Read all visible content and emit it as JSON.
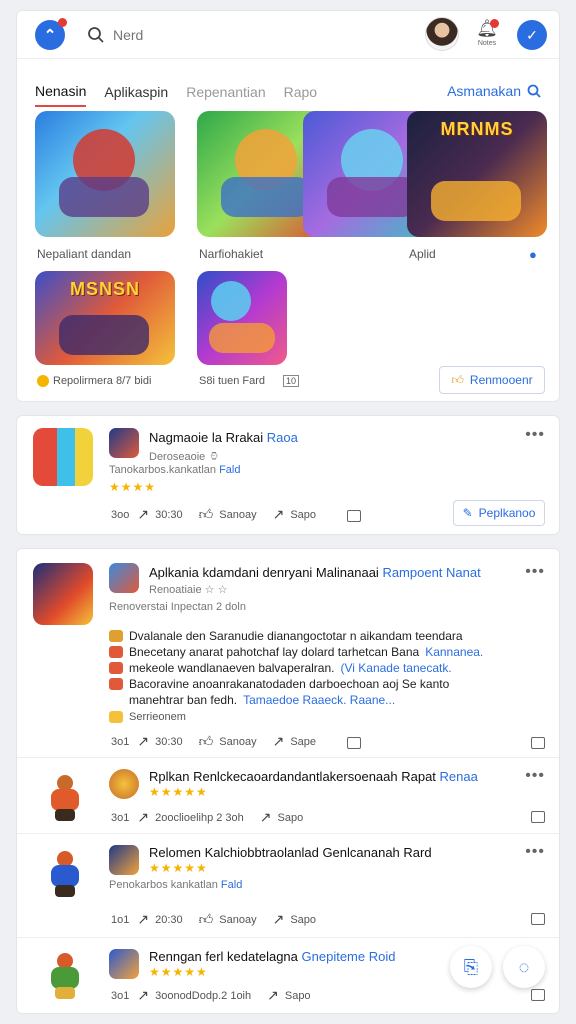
{
  "header": {
    "search_placeholder": "Nerd",
    "bell_label": "Notes",
    "app_icon": "app-icon",
    "check_icon": "check-icon"
  },
  "tabs": {
    "items": [
      "Nenasin",
      "Aplikaspin",
      "Repenantian",
      "Rapo"
    ],
    "active_index": 0,
    "right_label": "Asmanakan"
  },
  "gallery": {
    "caption_1": "Nepaliant dandan",
    "caption_2": "Narfiohakiet",
    "caption_3": "Aplid",
    "banner_text": "MSNSN",
    "banner_text_2": "MRNMS",
    "footer_caption_1": "Repolirmera 8/7 bidi",
    "footer_caption_2": "S8i tuen Fard",
    "footer_icon_text": "10",
    "action_button": "Renmooenr",
    "accent": "#2a6de0"
  },
  "post1": {
    "title": "Nagmaoie la Rrakai",
    "title_link": "Raoa",
    "subtitle": "Deroseaoie",
    "subtitle_extra": "Tanokarbos.kankatlan",
    "subtitle_link": "Fald",
    "stars": "★★★★",
    "action_time": "30:30",
    "action_share": "Sanoay",
    "action_save": "Sapo",
    "count": "3oo",
    "button": "Peplkanoo"
  },
  "post2": {
    "title": "Aplkania kdamdani denryani Malinanaai",
    "title_link": "Rampoent Nanat",
    "subtitle": "Renoatiaie",
    "meta": "Renoverstai Inpectan 2 doln",
    "lines": [
      {
        "text": "Dvalanale den Saranudie dianangoctotar n aikandam teendara",
        "link": ""
      },
      {
        "text": "Bnecetany anarat pahotchaf lay dolard tarhetcan Bana",
        "link": "Kannanea."
      },
      {
        "text": "mekeole wandlanaeven balvaperalran.",
        "link": "(Vi Kanade tanecatk."
      },
      {
        "text": "Bacoravine anoanrakanatodaden darboechoan aoj Se kanto",
        "link": ""
      },
      {
        "text": "manehtrar ban fedh.",
        "link": "Tamaedoe Raaeck. Raane..."
      }
    ],
    "tag": "Serrieonem",
    "count": "3o1",
    "action_time": "30:30",
    "action_share": "Sanoay",
    "action_save": "Sape"
  },
  "feed": [
    {
      "title": "Rplkan Renlckecaoardandantlakersoenaah Rapat",
      "title_link": "Renaa",
      "stars": "★★★★★",
      "count": "3o1",
      "time": "2ooclioelihp 2 3oh",
      "save": "Sapo"
    },
    {
      "title": "Relomen Kalchiobbtraolanlad Genlcananah Rard",
      "title_link": "",
      "stars": "★★★★★",
      "subtitle": "Penokarbos kankatlan",
      "subtitle_link": "Fald",
      "count": "1o1",
      "time": "20:30",
      "share": "Sanoay",
      "save": "Sapo"
    },
    {
      "title": "Renngan ferl kedatelagna",
      "title_link": "Gnepiteme Roid",
      "stars": "★★★★★",
      "count": "3o1",
      "time": "3oonodDodp.2 1oih",
      "save": "Sapo"
    }
  ]
}
